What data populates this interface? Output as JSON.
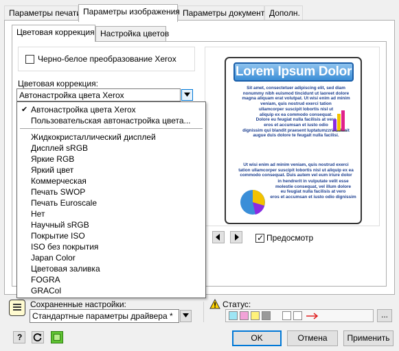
{
  "tabs": [
    {
      "label": "Параметры печати"
    },
    {
      "label": "Параметры изображения"
    },
    {
      "label": "Параметры документа"
    },
    {
      "label": "Дополн."
    }
  ],
  "subtabs": [
    {
      "label": "Цветовая коррекция"
    },
    {
      "label": "Настройка цветов"
    }
  ],
  "bw_checkbox": {
    "label": "Черно-белое преобразование Xerox",
    "checked": false
  },
  "color_correction": {
    "label": "Цветовая коррекция:",
    "selected": "Автонастройка цвета Xerox",
    "options": [
      "Автонастройка цвета Xerox",
      "Пользовательская автонастройка цвета...",
      "Жидкокристаллический дисплей",
      "Дисплей sRGB",
      "Яркие RGB",
      "Яркий цвет",
      "Коммерческая",
      "Печать SWOP",
      "Печать Euroscale",
      "Нет",
      "Научный sRGB",
      "Покрытие ISO",
      "ISO без покрытия",
      "Japan Color",
      "Цветовая заливка",
      "FOGRA",
      "GRACol"
    ]
  },
  "preview": {
    "title": "Lorem Ipsum Dolor",
    "para1": "Sit amet, consectetuer adipiscing elit, sed diam\nnonummy nibh euismod tincidunt ut laoreet dolore\nmagna aliquam erat volutpat. Ut wisi enim ad minim\nveniam, quis nostrud exerci tation\nullamcorper suscipit lobortis nisl ut\naliquip ex ea commodo consequat.\nDolore eu feugiat nulla facilisis at vero\neros et accumsan et iusto odio\ndignissim qui blandit praesent luptatumzzril delenit\naugue duis dolore te feugait nulla facilisi.",
    "para2": "Ut wisi enim ad minim veniam, quis nostrud exerci\ntation ullamcorper suscipit lobortis nisl ut aliquip ex ea\ncommodo consequat. Duis autem vel eum iriure dolor",
    "para3": "in hendrerit in vulputate velit esse\nmolestie consequat, vel illum dolore\neu feugiat nulla facilisis at vero\neros et accumsan et iusto odio dignissim",
    "show_label": "Предосмотр",
    "show_checked": true
  },
  "saved": {
    "label": "Сохраненные настройки:",
    "value": "Стандартные параметры драйвера *"
  },
  "status": {
    "label": "Статус:"
  },
  "buttons": {
    "ok": "OK",
    "cancel": "Отмена",
    "apply": "Применить",
    "more": "..."
  },
  "help_icon_text": "?",
  "colors": {
    "accent": "#0078d7",
    "page_bg": "#f0f0f0",
    "preview_title_bg": "#3b8ed6"
  }
}
